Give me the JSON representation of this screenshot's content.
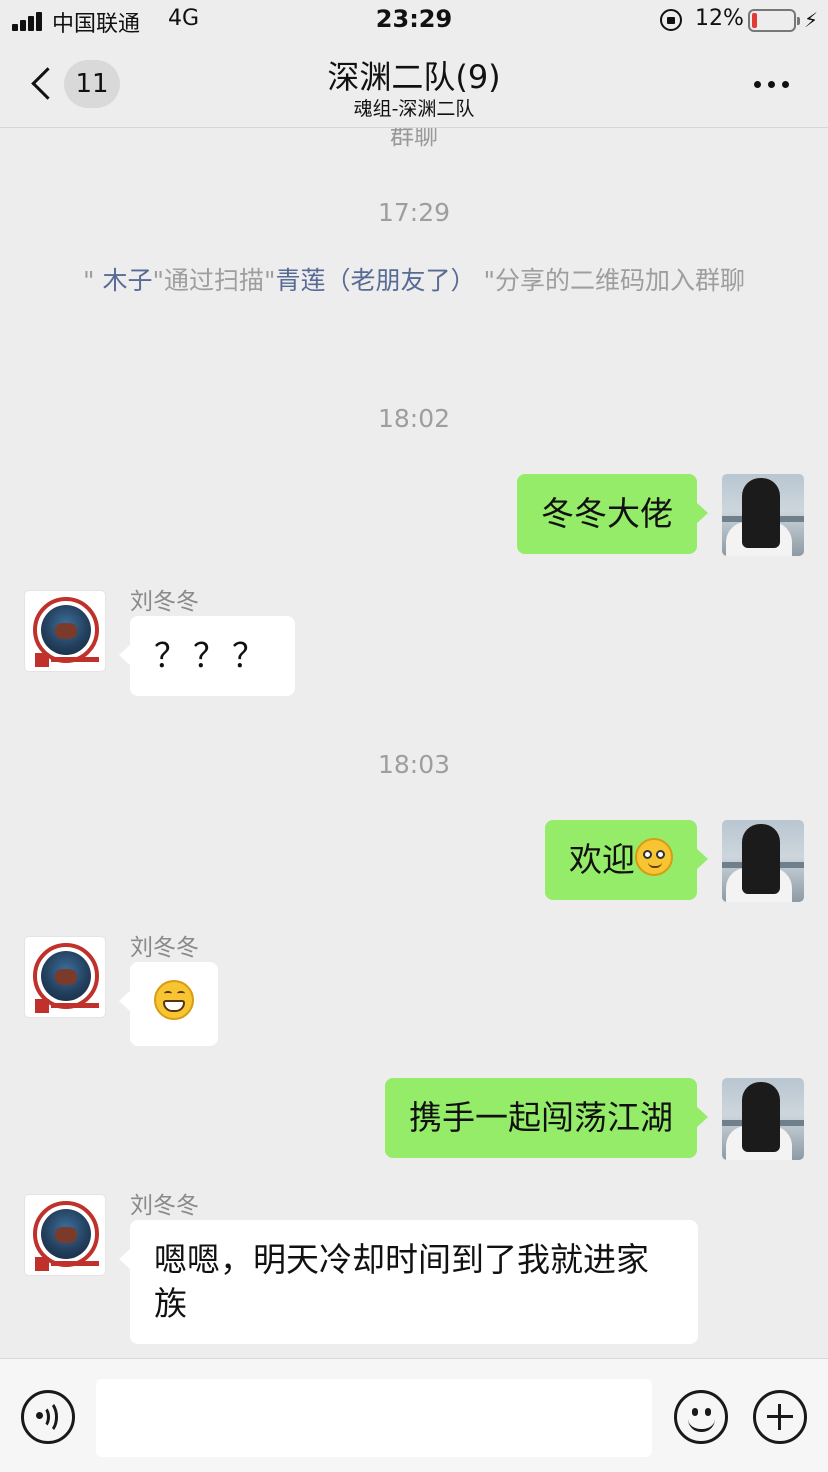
{
  "status_bar": {
    "carrier": "中国联通",
    "network": "4G",
    "time": "23:29",
    "battery_percent": "12%",
    "battery_level": 0.12,
    "colors": {
      "battery_low": "#e23b33"
    }
  },
  "nav": {
    "unread_count": "11",
    "title": "深渊二队(9)",
    "subtitle": "魂组-深渊二队",
    "icons": [
      "chevron-left-icon",
      "more-icon"
    ]
  },
  "chat": {
    "partial_top_text": "群聊",
    "timestamp_1": "17:29",
    "system_message": {
      "quote_1": "\"",
      "inviter": "木子",
      "quote_2": "\"通过扫描\"",
      "sharer": "青莲（老朋友了）",
      "quote_3": "\"分享的二维码加入群聊"
    },
    "timestamp_2": "18:02",
    "messages": [
      {
        "direction": "out",
        "text": "冬冬大佬"
      },
      {
        "direction": "in",
        "sender": "刘冬冬",
        "text": "？？？"
      },
      {
        "direction": "out",
        "text": "欢迎",
        "emoji": "wink-emoji"
      },
      {
        "direction": "in",
        "sender": "刘冬冬",
        "emoji": "grin-emoji"
      },
      {
        "direction": "out",
        "text": "携手一起闯荡江湖"
      },
      {
        "direction": "in",
        "sender": "刘冬冬",
        "text": "嗯嗯，明天冷却时间到了我就进家族"
      }
    ],
    "timestamp_3": "18:03",
    "colors": {
      "out_bubble": "#95ec69",
      "in_bubble": "#ffffff",
      "link_name": "#576b95",
      "background": "#ededed"
    }
  },
  "input_bar": {
    "value": "",
    "icons": [
      "voice-icon",
      "emoji-icon",
      "plus-icon"
    ]
  }
}
